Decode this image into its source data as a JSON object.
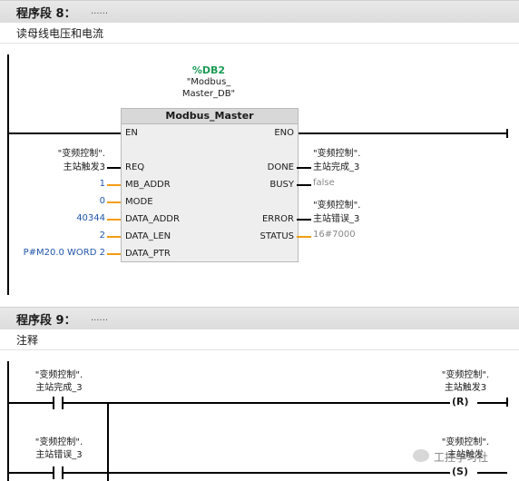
{
  "segment8": {
    "title": "程序段 8：",
    "dots": "......",
    "comment": "读母线电压和电流",
    "instance": {
      "db": "%DB2",
      "name_line1": "\"Modbus_",
      "name_line2": "Master_DB\""
    },
    "block": {
      "title": "Modbus_Master",
      "inputs": [
        "EN",
        "REQ",
        "MB_ADDR",
        "MODE",
        "DATA_ADDR",
        "DATA_LEN",
        "DATA_PTR"
      ],
      "outputs": [
        "ENO",
        "DONE",
        "BUSY",
        "ERROR",
        "STATUS"
      ]
    },
    "operands_in": {
      "req_line1": "\"变频控制\".",
      "req_line2": "主站触发3",
      "mb_addr": "1",
      "mode": "0",
      "data_addr": "40344",
      "data_len": "2",
      "data_ptr": "P#M20.0 WORD 2"
    },
    "operands_out": {
      "done_line1": "\"变频控制\".",
      "done_line2": "主站完成_3",
      "busy": "false",
      "error_line1": "\"变频控制\".",
      "error_line2": "主站错误_3",
      "status": "16#7000"
    }
  },
  "segment9": {
    "title": "程序段 9：",
    "dots": "......",
    "comment": "注释",
    "rung1": {
      "contact_line1": "\"变频控制\".",
      "contact_line2": "主站完成_3",
      "coil_line1": "\"变频控制\".",
      "coil_line2": "主站触发3",
      "coil_type": "R"
    },
    "rung2": {
      "contact_line1": "\"变频控制\".",
      "contact_line2": "主站错误_3",
      "coil_line1": "\"变频控制\".",
      "coil_line2": "主站触发",
      "coil_type": "S"
    }
  },
  "watermark": "工控学习社"
}
